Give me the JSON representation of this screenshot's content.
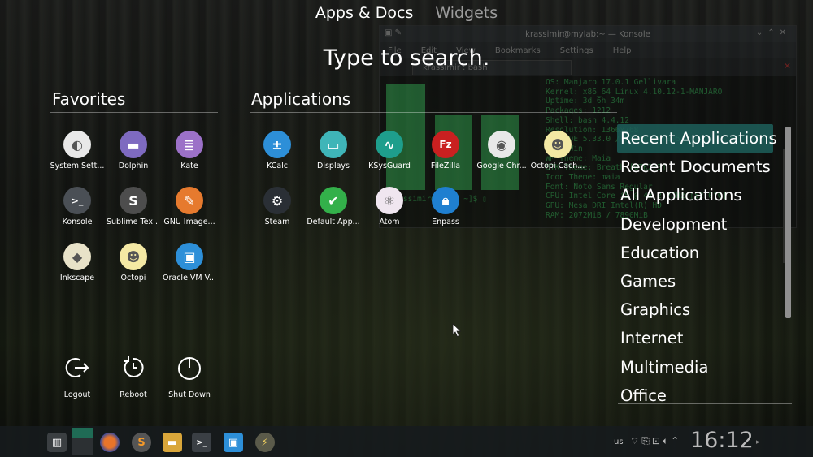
{
  "header": {
    "tabs": [
      {
        "label": "Apps & Docs",
        "active": true
      },
      {
        "label": "Widgets",
        "active": false
      }
    ],
    "search_hint": "Type to search."
  },
  "favorites": {
    "title": "Favorites",
    "items": [
      {
        "label": "System Sett...",
        "icon": "toggle-icon",
        "color": "#e8e8e8"
      },
      {
        "label": "Dolphin",
        "icon": "folder-icon",
        "color": "#7e6ac0"
      },
      {
        "label": "Kate",
        "icon": "document-icon",
        "color": "#9c71c8"
      },
      {
        "label": "Konsole",
        "icon": "terminal-icon",
        "color": "#4a4f55"
      },
      {
        "label": "Sublime Tex...",
        "icon": "sublime-icon",
        "color": "#4d4d4d"
      },
      {
        "label": "GNU Image...",
        "icon": "gimp-icon",
        "color": "#e67a2e"
      },
      {
        "label": "Inkscape",
        "icon": "inkscape-icon",
        "color": "#e8e2c8"
      },
      {
        "label": "Octopi",
        "icon": "octopi-icon",
        "color": "#f4e9a4"
      },
      {
        "label": "Oracle VM V...",
        "icon": "virtualbox-icon",
        "color": "#2d8fd8"
      }
    ]
  },
  "applications": {
    "title": "Applications",
    "items": [
      {
        "label": "KCalc",
        "icon": "calculator-icon",
        "color": "#2d8fd8"
      },
      {
        "label": "Displays",
        "icon": "monitor-icon",
        "color": "#3fb5b8"
      },
      {
        "label": "KSysGuard",
        "icon": "pulse-icon",
        "color": "#1e9e8c"
      },
      {
        "label": "FileZilla",
        "icon": "filezilla-icon",
        "color": "#c92020"
      },
      {
        "label": "Google Chr...",
        "icon": "chrome-icon",
        "color": "#e8e8e8"
      },
      {
        "label": "Octopi Cach...",
        "icon": "octopi-cache-icon",
        "color": "#f4e9a4"
      },
      {
        "label": "Steam",
        "icon": "steam-icon",
        "color": "#2a2f35"
      },
      {
        "label": "Default App...",
        "icon": "check-icon",
        "color": "#33b04a"
      },
      {
        "label": "Atom",
        "icon": "atom-icon",
        "color": "#f0e6f0"
      },
      {
        "label": "Enpass",
        "icon": "lock-icon",
        "color": "#1f7fd0"
      }
    ]
  },
  "categories": {
    "items": [
      {
        "label": "Recent Applications",
        "selected": true
      },
      {
        "label": "Recent Documents",
        "selected": false
      },
      {
        "label": "All Applications",
        "selected": false
      },
      {
        "label": "Development",
        "selected": false
      },
      {
        "label": "Education",
        "selected": false
      },
      {
        "label": "Games",
        "selected": false
      },
      {
        "label": "Graphics",
        "selected": false
      },
      {
        "label": "Internet",
        "selected": false
      },
      {
        "label": "Multimedia",
        "selected": false
      },
      {
        "label": "Office",
        "selected": false
      }
    ]
  },
  "power": {
    "logout": "Logout",
    "reboot": "Reboot",
    "shutdown": "Shut Down"
  },
  "konsole": {
    "title": "krassimir@mylab:~ — Konsole",
    "menu": [
      "File",
      "Edit",
      "View",
      "Bookmarks",
      "Settings",
      "Help"
    ],
    "tab": "krassimir : bash",
    "info_lines": [
      "OS: Manjaro 17.0.1 Gellivara",
      "Kernel: x86_64 Linux 4.10.12-1-MANJARO",
      "Uptime: 3d 6h 34m",
      "Packages: 1212",
      "Shell: bash 4.4.12",
      "Resolution: 1366x768",
      "DE: KDE 5.33.0 / Plasma 5.9.5",
      "WM: KWin",
      "WM Theme: Maia",
      "GTK Theme: Breath [GTK2/3]",
      "Icon Theme: maia",
      "Font: Noto Sans Regular",
      "CPU: Intel Core i5 @ 4x 2.7GHz [52.0°C]",
      "GPU: Mesa DRI Intel(R) HD",
      "RAM: 2072MiB / 7890MiB"
    ],
    "prompt": "[krassimir@mylab ~]$ ▯"
  },
  "taskbar": {
    "keyboard_layout": "us",
    "clock": "16:12"
  },
  "colors": {
    "accent": "#1d5f5a",
    "manjaro_green": "#35bf5c"
  }
}
